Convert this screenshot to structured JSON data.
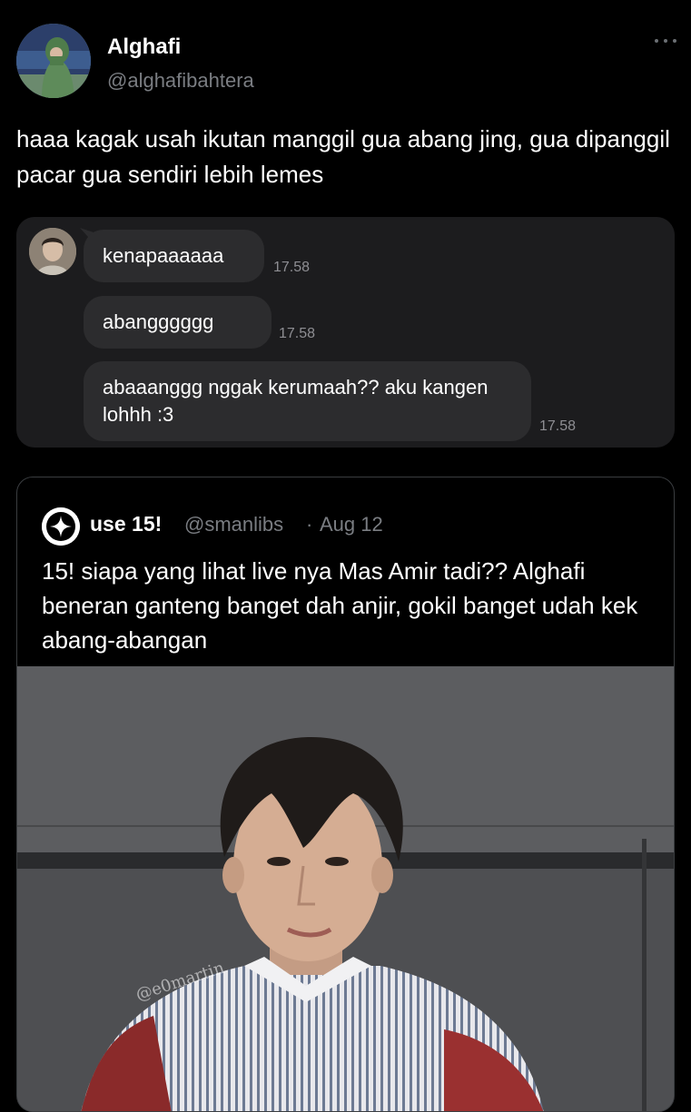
{
  "author": {
    "name": "Alghafi",
    "handle": "@alghafibahtera"
  },
  "tweet": {
    "text": "haaa kagak usah ikutan manggil gua abang jing, gua dipanggil pacar gua sendiri lebih lemes"
  },
  "chat": {
    "messages": [
      {
        "text": "kenapaaaaaa",
        "time": "17.58"
      },
      {
        "text": "abangggggg",
        "time": "17.58"
      },
      {
        "text": "abaaanggg nggak kerumaah?? aku kangen lohhh :3",
        "time": "17.58"
      }
    ]
  },
  "quote": {
    "name": "use 15!",
    "handle": "@smanlibs",
    "separator": "·",
    "date": "Aug 12",
    "text": "15! siapa yang lihat live nya Mas Amir tadi?? Alghafi beneran ganteng banget dah anjir, gokil banget udah kek abang-abangan",
    "watermark": "@e0martin"
  },
  "icons": {
    "more": "more-horizontal-icon",
    "sparkle": "sparkle-icon"
  },
  "colors": {
    "background": "#000000",
    "secondary_text": "#7a7d82",
    "bubble": "#2c2c2e",
    "chat_card": "#1c1c1e"
  }
}
